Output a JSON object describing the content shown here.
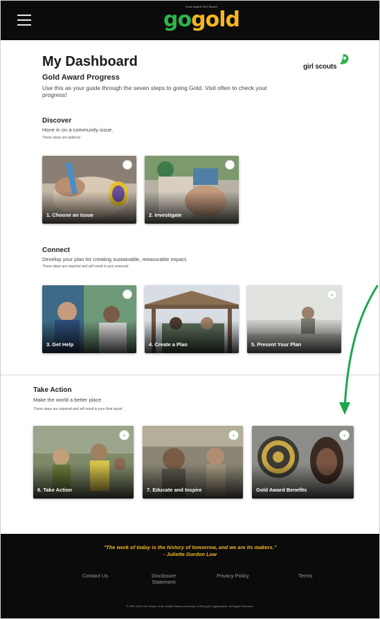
{
  "header": {
    "menu_icon": "hamburger-menu-icon",
    "logo_small": "Gold Award Girl Board",
    "logo_go": "go",
    "logo_gold": "gold",
    "brand_colors": {
      "go": "#2db34a",
      "gold": "#f3b61f",
      "bar": "#0b0b0b"
    }
  },
  "page": {
    "title": "My Dashboard",
    "partner_logo_text": "girl scouts",
    "subtitle": "Gold Award Progress",
    "intro": "Use this as your guide through the seven steps to going Gold. Visit often to check your progress!"
  },
  "discover": {
    "title": "Discover",
    "desc": "Hone in on a community issue.",
    "note": "These steps are optional",
    "cards": [
      {
        "label": "1. Choose an Issue",
        "status": "incomplete"
      },
      {
        "label": "2. Investigate",
        "status": "incomplete"
      }
    ]
  },
  "connect": {
    "title": "Connect",
    "desc": "Develop your plan for creating sustainable, measurable impact.",
    "note": "These steps are required and will result in your proposal",
    "cards": [
      {
        "label": "3. Get Help",
        "status": "incomplete"
      },
      {
        "label": "4. Create a Plan",
        "status": "not-started"
      },
      {
        "label": "5. Present Your Plan",
        "status": "locked"
      }
    ]
  },
  "take_action": {
    "title": "Take Action",
    "desc": "Make the world a better place.",
    "note": "These steps are required and will result in your final report",
    "cards": [
      {
        "label": "6. Take Action",
        "status": "locked"
      },
      {
        "label": "7. Educate and Inspire",
        "status": "locked"
      },
      {
        "label": "Gold Award Benefits",
        "status": "locked"
      }
    ]
  },
  "footer": {
    "quote": "\"The work of today is the history of tomorrow, and we are its makers.\"",
    "quote_author": "- Juliette Gordon Low",
    "links": {
      "contact": "Contact Us",
      "disclosure_1": "Disclosure",
      "disclosure_2": "Statement",
      "privacy": "Privacy Policy",
      "terms": "Terms"
    },
    "copyright": "© 1991-2018 Girl Scouts of the United States of America. A 501(c)(3) Organization. All Rights Reserved."
  },
  "annotation": {
    "arrow_color": "#1aa64a"
  }
}
